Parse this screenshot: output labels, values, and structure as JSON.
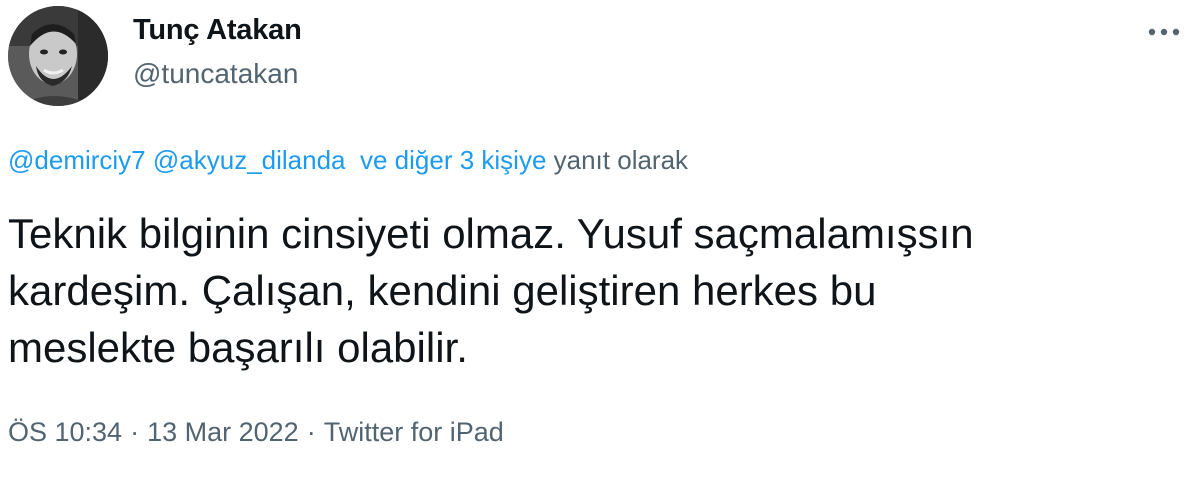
{
  "author": {
    "display_name": "Tunç Atakan",
    "handle": "@tuncatakan",
    "avatar_icon": "profile-photo"
  },
  "more_icon": "ellipsis-icon",
  "reply": {
    "mentions": [
      "@demirciy7",
      "@akyuz_dilanda"
    ],
    "others_link": "ve diğer 3 kişiye",
    "suffix": "yanıt olarak"
  },
  "tweet": {
    "lines": [
      "Teknik bilginin cinsiyeti olmaz. Yusuf saçmalamışsın",
      "kardeşim. Çalışan, kendini geliştiren herkes bu",
      "meslekte başarılı olabilir."
    ]
  },
  "meta": {
    "time": "ÖS 10:34",
    "separator": "·",
    "date": "13 Mar 2022",
    "source": "Twitter for iPad"
  },
  "colors": {
    "link": "#1d9bf0",
    "secondary_text": "#536471",
    "primary_text": "#0f1419"
  }
}
